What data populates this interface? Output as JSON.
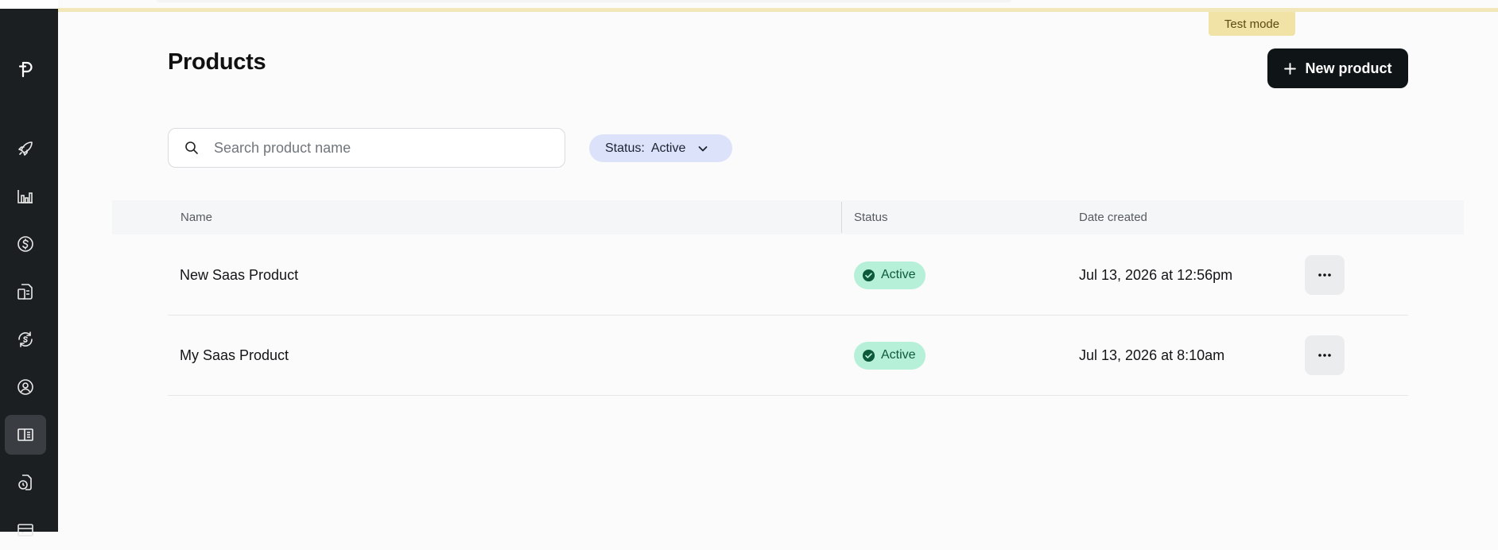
{
  "banner": {
    "test_mode": "Test mode"
  },
  "sidebar": {
    "logo": "polar-logo-icon",
    "items": [
      {
        "icon": "rocket-icon",
        "active": false
      },
      {
        "icon": "bar-chart-icon",
        "active": false
      },
      {
        "icon": "dollar-circle-icon",
        "active": false
      },
      {
        "icon": "invoice-icon",
        "active": false
      },
      {
        "icon": "subscription-icon",
        "active": false
      },
      {
        "icon": "user-circle-icon",
        "active": false
      },
      {
        "icon": "products-panel-icon",
        "active": true
      },
      {
        "icon": "document-clock-icon",
        "active": false
      },
      {
        "icon": "credit-card-icon",
        "active": false
      }
    ]
  },
  "header": {
    "title": "Products",
    "new_button_label": "New product"
  },
  "filters": {
    "search_placeholder": "Search product name",
    "search_value": "",
    "status_label": "Status:",
    "status_value": "Active"
  },
  "table": {
    "columns": [
      "Name",
      "Status",
      "Date created"
    ],
    "rows": [
      {
        "name": "New Saas Product",
        "status": "Active",
        "date": "Jul 13, 2026 at 12:56pm"
      },
      {
        "name": "My Saas Product",
        "status": "Active",
        "date": "Jul 13, 2026 at 8:10am"
      }
    ]
  },
  "colors": {
    "sidebar_bg": "#1c1f22",
    "primary_button": "#0f1416",
    "status_filter_bg": "#dde2fb",
    "active_badge_bg": "#b7f0d8",
    "active_badge_fg": "#0d5a3b",
    "test_mode_bg": "#f1e3a6"
  }
}
